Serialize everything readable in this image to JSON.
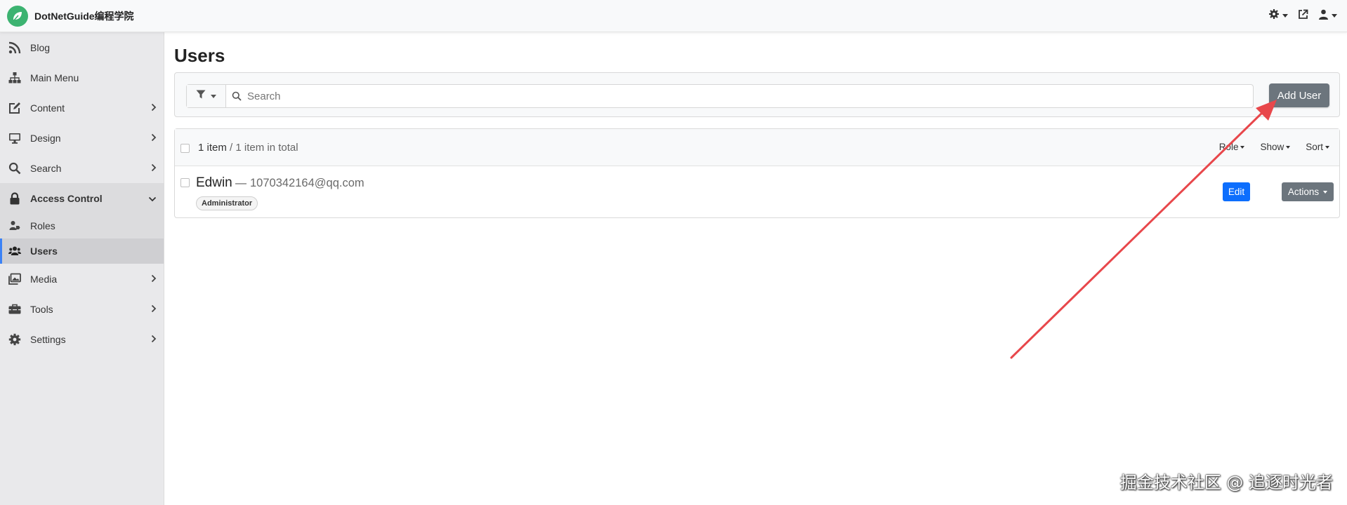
{
  "app": {
    "brand_name": "DotNetGuide编程学院",
    "brand_color": "#3cb371"
  },
  "topbar": {
    "icons": [
      "gear-icon",
      "external-link-icon",
      "user-icon"
    ]
  },
  "sidebar": {
    "items": [
      {
        "label": "Blog",
        "icon": "rss-icon"
      },
      {
        "label": "Main Menu",
        "icon": "sitemap-icon"
      },
      {
        "label": "Content",
        "icon": "edit-icon"
      },
      {
        "label": "Design",
        "icon": "desktop-icon"
      },
      {
        "label": "Search",
        "icon": "search-icon"
      },
      {
        "label": "Access Control",
        "icon": "lock-icon",
        "open": true
      },
      {
        "label": "Roles",
        "icon": "user-tag-icon"
      },
      {
        "label": "Users",
        "icon": "users-icon",
        "active": true
      },
      {
        "label": "Media",
        "icon": "images-icon"
      },
      {
        "label": "Tools",
        "icon": "toolbox-icon"
      },
      {
        "label": "Settings",
        "icon": "gear-icon"
      }
    ]
  },
  "page": {
    "title": "Users"
  },
  "filter": {
    "search_placeholder": "Search",
    "add_user_label": "Add User"
  },
  "list": {
    "count_label": "1 item",
    "total_label": " / 1 item in total",
    "menus": {
      "role": "Role",
      "show": "Show",
      "sort": "Sort"
    },
    "users": [
      {
        "name": "Edwin",
        "separator": "—",
        "email": "1070342164@qq.com",
        "role": "Administrator",
        "edit_label": "Edit",
        "actions_label": "Actions"
      }
    ]
  },
  "colors": {
    "primary": "#0d6efd",
    "secondary": "#6c757d",
    "annotation_arrow": "#e8474b",
    "active_border": "#3b82f6"
  },
  "watermark": "掘金技术社区 @ 追逐时光者"
}
